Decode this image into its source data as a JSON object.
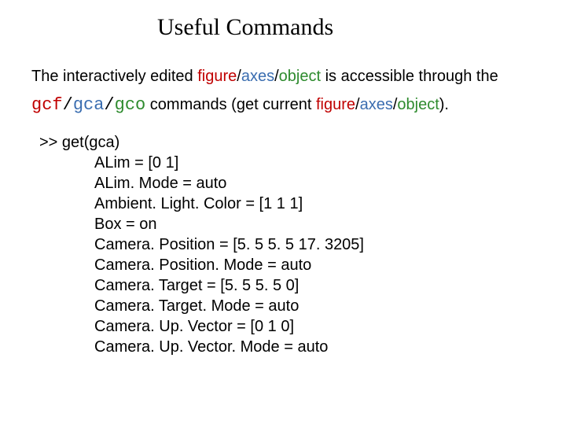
{
  "title": "Useful Commands",
  "para": {
    "t1": "The interactively edited ",
    "figure": "figure",
    "sep": "/",
    "axes": "axes",
    "object": "object",
    "t2": " is accessible through the ",
    "cmd_gcf": "gcf",
    "cmd_sep": "/",
    "cmd_gca": "gca",
    "cmd_gco": "gco",
    "t3": " commands (get current ",
    "figure2": "figure",
    "axes2": "axes",
    "object2": "object",
    "t4": ")."
  },
  "output": {
    "prompt": ">> get(gca)",
    "lines": [
      "ALim = [0 1]",
      "ALim. Mode = auto",
      "Ambient. Light. Color = [1 1 1]",
      "Box = on",
      "Camera. Position = [5. 5 5. 5 17. 3205]",
      "Camera. Position. Mode = auto",
      "Camera. Target = [5. 5 5. 5 0]",
      "Camera. Target. Mode = auto",
      "Camera. Up. Vector = [0 1 0]",
      "Camera. Up. Vector. Mode = auto"
    ]
  }
}
